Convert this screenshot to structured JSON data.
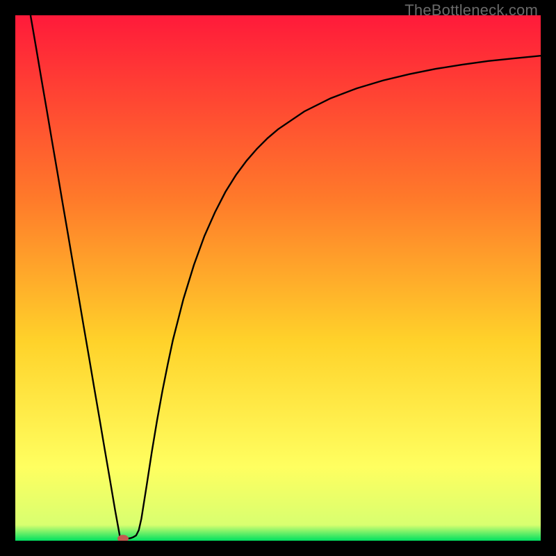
{
  "watermark": "TheBottleneck.com",
  "colors": {
    "gradient_top": "#ff1a3a",
    "gradient_mid1": "#ff7a2a",
    "gradient_mid2": "#ffd22a",
    "gradient_mid3": "#ffff60",
    "gradient_bot": "#00e060",
    "curve": "#000000",
    "marker": "#c45a50",
    "frame": "#000000"
  },
  "chart_data": {
    "type": "line",
    "title": "",
    "xlabel": "",
    "ylabel": "",
    "xlim": [
      0,
      100
    ],
    "ylim": [
      0,
      100
    ],
    "x": [
      2.9,
      4,
      5,
      6,
      7,
      8,
      9,
      10,
      11,
      12,
      13,
      14,
      15,
      16,
      17,
      18,
      19,
      20,
      20,
      20.5,
      21,
      21.5,
      22,
      22.5,
      23,
      23.5,
      24,
      25,
      26,
      27,
      28,
      29,
      30,
      32,
      34,
      36,
      38,
      40,
      42,
      44,
      46,
      48,
      50,
      55,
      60,
      65,
      70,
      75,
      80,
      85,
      90,
      95,
      100
    ],
    "values": [
      100,
      93.6,
      87.7,
      81.9,
      76.0,
      70.2,
      64.3,
      58.5,
      52.6,
      46.8,
      40.9,
      35.1,
      29.2,
      23.4,
      17.5,
      11.7,
      5.8,
      0.3,
      0.3,
      0.3,
      0.3,
      0.4,
      0.5,
      0.7,
      1.0,
      2.0,
      4.2,
      10.5,
      17.0,
      23.0,
      28.5,
      33.5,
      38.2,
      46.0,
      52.5,
      58.0,
      62.5,
      66.4,
      69.6,
      72.3,
      74.6,
      76.6,
      78.3,
      81.7,
      84.2,
      86.1,
      87.6,
      88.8,
      89.8,
      90.6,
      91.3,
      91.8,
      92.3
    ],
    "marker": {
      "x": 20.5,
      "y": 0.4
    },
    "grid": false,
    "legend": null
  }
}
